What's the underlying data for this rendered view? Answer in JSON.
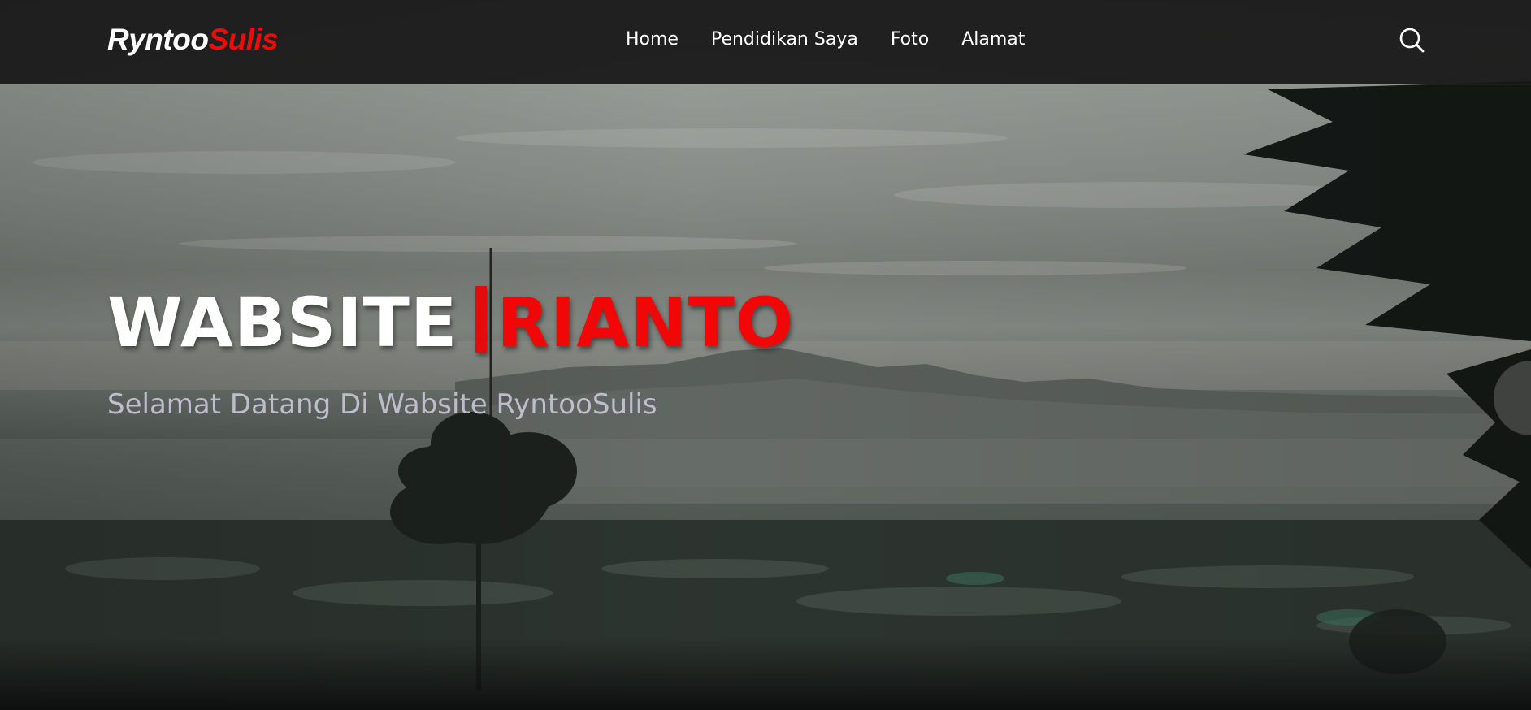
{
  "brand": {
    "name_main": "Ryntoo",
    "name_accent": "Sulis"
  },
  "nav": {
    "items": [
      {
        "label": "Home"
      },
      {
        "label": "Pendidikan Saya"
      },
      {
        "label": "Foto"
      },
      {
        "label": "Alamat"
      }
    ],
    "search_icon": "search-icon"
  },
  "hero": {
    "title_part1": "WABSITE",
    "title_part2": "RIANTO",
    "subtitle": "Selamat Datang Di Wabsite RyntooSulis"
  },
  "colors": {
    "accent": "#f00a0a",
    "navbar_bg": "#181818",
    "text": "#ffffff",
    "subtitle": "#c8c4d6"
  }
}
